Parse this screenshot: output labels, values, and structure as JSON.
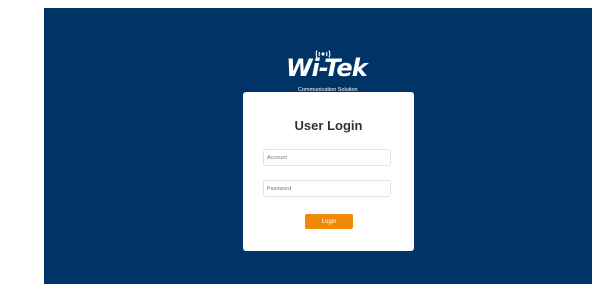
{
  "brand": {
    "name": "Wi-Tek",
    "tagline": "Communication Solution"
  },
  "login": {
    "title": "User Login",
    "account_placeholder": "Account",
    "password_placeholder": "Password",
    "submit_label": "Login"
  },
  "colors": {
    "background": "#003366",
    "card": "#ffffff",
    "accent": "#f08a05"
  }
}
